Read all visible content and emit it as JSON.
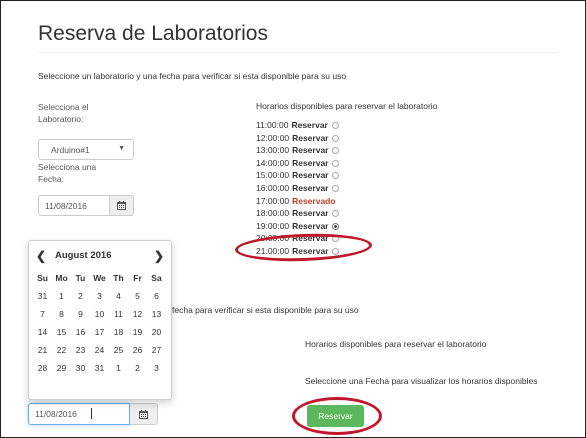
{
  "page": {
    "title": "Reserva de Laboratorios",
    "intro": "Seleccione un laboratorio y una fecha para verificar si esta disponible para su uso"
  },
  "form": {
    "lab_label_1": "Selecciona el",
    "lab_label_2": "Laboratorio:",
    "lab_select_value": "Arduino#1",
    "date_label_1": "Selecciona una",
    "date_label_2": "Fecha:",
    "date_value": "11/08/2016"
  },
  "schedule": {
    "heading": "Horarios disponibles para reservar el laboratorio",
    "slots": [
      {
        "time": "11:00:00",
        "status": "Reservar",
        "taken": false,
        "selected": false
      },
      {
        "time": "12:00:00",
        "status": "Reservar",
        "taken": false,
        "selected": false
      },
      {
        "time": "13:00:00",
        "status": "Reservar",
        "taken": false,
        "selected": false
      },
      {
        "time": "14:00:00",
        "status": "Reservar",
        "taken": false,
        "selected": false
      },
      {
        "time": "15:00:00",
        "status": "Reservar",
        "taken": false,
        "selected": false
      },
      {
        "time": "16:00:00",
        "status": "Reservar",
        "taken": false,
        "selected": false
      },
      {
        "time": "17:00:00",
        "status": "Reservado",
        "taken": true,
        "selected": false
      },
      {
        "time": "18:00:00",
        "status": "Reservar",
        "taken": false,
        "selected": false
      },
      {
        "time": "19:00:00",
        "status": "Reservar",
        "taken": false,
        "selected": true
      },
      {
        "time": "20:00:00",
        "status": "Reservar",
        "taken": false,
        "selected": false
      },
      {
        "time": "21:00:00",
        "status": "Reservar",
        "taken": false,
        "selected": false
      }
    ]
  },
  "lower": {
    "intro_fragment": "fecha para verificar si esta disponible para su uso",
    "schedule_heading": "Horarios disponibles para reservar el laboratorio",
    "select_date_msg": "Seleccione una Fecha para visualizar los horarios disponibles",
    "date_value": "11/08/2016",
    "reserve_button": "Reservar"
  },
  "calendar": {
    "prev": "❮",
    "next": "❯",
    "month_label": "August 2016",
    "weekdays": [
      "Su",
      "Mo",
      "Tu",
      "We",
      "Th",
      "Fr",
      "Sa"
    ],
    "weeks": [
      [
        "31",
        "1",
        "2",
        "3",
        "4",
        "5",
        "6"
      ],
      [
        "7",
        "8",
        "9",
        "10",
        "11",
        "12",
        "13"
      ],
      [
        "14",
        "15",
        "16",
        "17",
        "18",
        "19",
        "20"
      ],
      [
        "21",
        "22",
        "23",
        "24",
        "25",
        "26",
        "27"
      ],
      [
        "28",
        "29",
        "30",
        "31",
        "1",
        "2",
        "3"
      ]
    ]
  },
  "colors": {
    "accent_red": "#c0182a",
    "reserved_red": "#c0392b",
    "button_green": "#5cb85c"
  }
}
